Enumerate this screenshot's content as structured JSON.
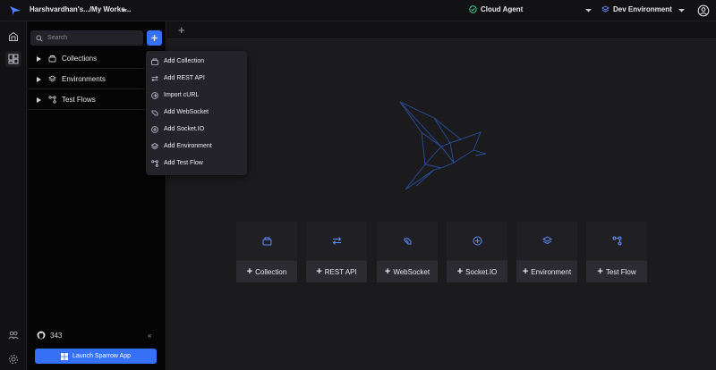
{
  "header": {
    "workspace_title": "Harshvardhan's.../My Works...",
    "agent_label": "Cloud Agent",
    "environment_label": "Dev Environment",
    "colors": {
      "accent": "#3670f7",
      "agent_ok": "#3ecf8e",
      "env_icon": "#5f8dff"
    }
  },
  "left_rail": {
    "items": [
      {
        "icon": "home-icon"
      },
      {
        "icon": "collections-grid-icon"
      },
      {
        "icon": "team-icon"
      },
      {
        "icon": "settings-icon"
      }
    ]
  },
  "sidebar": {
    "search_placeholder": "Search",
    "tree": [
      {
        "label": "Collections",
        "icon": "collection-icon"
      },
      {
        "label": "Environments",
        "icon": "layers-icon"
      },
      {
        "label": "Test Flows",
        "icon": "flow-icon"
      }
    ],
    "github_stars": "343",
    "collapse_label": "«",
    "launch_label": "Launch Sparrow App"
  },
  "add_menu": {
    "items": [
      {
        "label": "Add Collection",
        "icon": "collection-icon"
      },
      {
        "label": "Add REST API",
        "icon": "swap-arrows-icon"
      },
      {
        "label": "Import cURL",
        "icon": "import-icon"
      },
      {
        "label": "Add WebSocket",
        "icon": "plug-icon"
      },
      {
        "label": "Add Socket.IO",
        "icon": "socketio-icon"
      },
      {
        "label": "Add Environment",
        "icon": "layers-icon"
      },
      {
        "label": "Add Test Flow",
        "icon": "flow-icon"
      }
    ]
  },
  "main": {
    "new_tab_label": "+",
    "quick_actions": [
      {
        "label": "Collection",
        "icon": "collection-icon"
      },
      {
        "label": "REST API",
        "icon": "swap-arrows-icon"
      },
      {
        "label": "WebSocket",
        "icon": "plug-icon"
      },
      {
        "label": "Socket.IO",
        "icon": "socketio-icon"
      },
      {
        "label": "Environment",
        "icon": "layers-icon"
      },
      {
        "label": "Test Flow",
        "icon": "flow-icon"
      }
    ]
  }
}
